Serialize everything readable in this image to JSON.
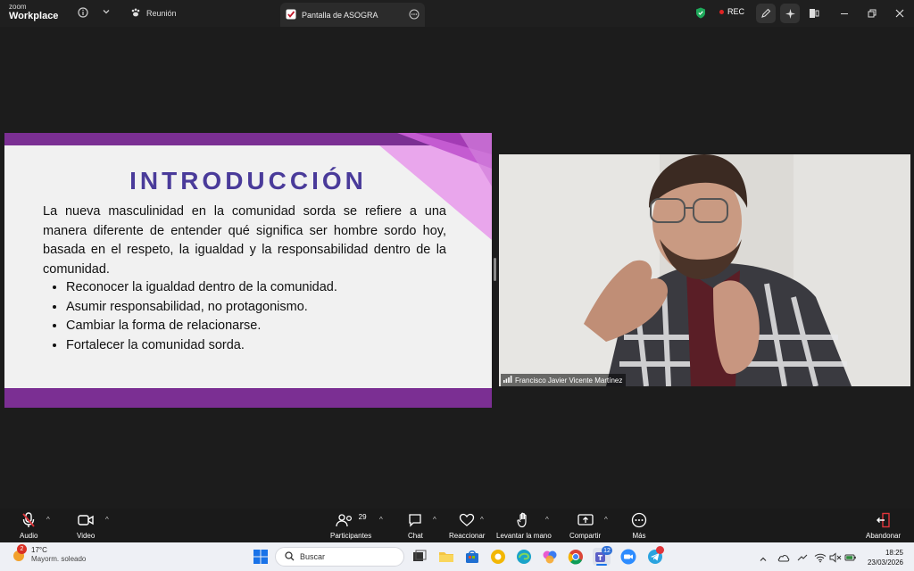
{
  "titlebar": {
    "logo_top": "zoom",
    "logo_bottom": "Workplace",
    "tab_meeting": "Reunión",
    "tab_screen": "Pantalla de ASOGRA",
    "rec_label": "REC"
  },
  "slide": {
    "title": "INTRODUCCIÓN",
    "paragraph": "La nueva masculinidad en la comunidad sorda se refiere a una manera diferente de entender qué significa ser hombre sordo hoy, basada en el respeto, la igualdad y la responsabilidad dentro de la comunidad.",
    "bullets": [
      "Reconocer la igualdad dentro de la comunidad.",
      "Asumir responsabilidad, no protagonismo.",
      "Cambiar la forma de relacionarse.",
      "Fortalecer la comunidad sorda."
    ]
  },
  "video": {
    "participant_name": "Francisco Javier Vicente Martínez"
  },
  "toolbar": {
    "audio": "Audio",
    "video": "Video",
    "participants": "Participantes",
    "participants_count": "29",
    "chat": "Chat",
    "react": "Reaccionar",
    "raise_hand": "Levantar la mano",
    "share": "Compartir",
    "more": "Más",
    "leave": "Abandonar"
  },
  "taskbar": {
    "weather_temp": "17°C",
    "weather_desc": "Mayorm. soleado",
    "weather_badge": "2",
    "search_placeholder": "Buscar",
    "teams_badge": "12",
    "time": "18:25",
    "date": "23/03/2026"
  },
  "colors": {
    "slide_band": "#7b2f93",
    "slide_title": "#4a3b9a",
    "rec_dot": "#e02424",
    "leave_red": "#e0353b"
  }
}
